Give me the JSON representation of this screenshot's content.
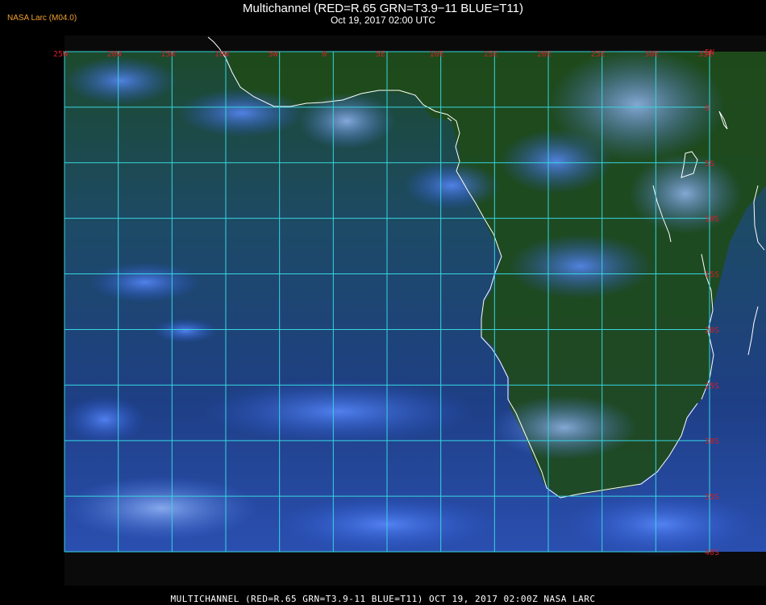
{
  "header": {
    "title": "Multichannel (RED=R.65 GRN=T3.9−11 BLUE=T11)",
    "subtitle": "Oct 19, 2017 02:00 UTC",
    "credit": "NASA Larc (M04.0)"
  },
  "footer": {
    "caption": "MULTICHANNEL (RED=R.65 GRN=T3.9-11 BLUE=T11) OCT 19, 2017 02:00Z  NASA LARC"
  },
  "map": {
    "extent": {
      "lon_min": -25,
      "lon_max": 35,
      "lat_max": 5,
      "lat_min": -40
    },
    "lon_labels": [
      "25W",
      "20W",
      "15W",
      "10W",
      "5W",
      "0",
      "5E",
      "10E",
      "15E",
      "20E",
      "25E",
      "30E",
      "35E"
    ],
    "lon_values": [
      -25,
      -20,
      -15,
      -10,
      -5,
      0,
      5,
      10,
      15,
      20,
      25,
      30,
      35
    ],
    "lat_labels": [
      "5N",
      "0",
      "5S",
      "10S",
      "15S",
      "20S",
      "25S",
      "30S",
      "35S",
      "40S"
    ],
    "lat_values": [
      5,
      0,
      -5,
      -10,
      -15,
      -20,
      -25,
      -30,
      -35,
      -40
    ],
    "colors": {
      "grid": "#36d6e0",
      "coast": "#ffffff",
      "label": "#d0202a",
      "ocean": "#1c3f7a",
      "land": "#1f4a1a"
    }
  }
}
